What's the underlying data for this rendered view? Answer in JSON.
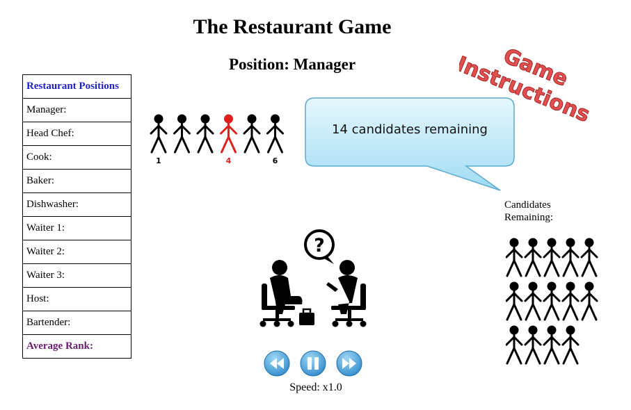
{
  "title": "The Restaurant Game",
  "position_line": "Position: Manager",
  "positions": {
    "header": "Restaurant Positions",
    "rows": [
      "Manager:",
      "Head Chef:",
      "Cook:",
      "Baker:",
      "Dishwasher:",
      "Waiter 1:",
      "Waiter 2:",
      "Waiter 3:",
      "Host:",
      "Bartender:"
    ],
    "average": "Average Rank:"
  },
  "lineup": {
    "count": 6,
    "highlighted_index": 4,
    "labels": [
      {
        "index": 1,
        "text": "1"
      },
      {
        "index": 4,
        "text": "4"
      },
      {
        "index": 6,
        "text": "6"
      }
    ],
    "figure_color": "#000000",
    "highlight_color": "#e02020"
  },
  "speech": {
    "text": "14 candidates remaining"
  },
  "instructions": {
    "line1": "Game",
    "line2": "Instructions",
    "color": "#e05050"
  },
  "candidates": {
    "label_line1": "Candidates",
    "label_line2": "Remaining:",
    "count": 14
  },
  "controls": {
    "rewind_icon": "rewind-icon",
    "pause_icon": "pause-icon",
    "forward_icon": "fast-forward-icon",
    "button_color": "#3a9fd8"
  },
  "speed": "Speed: x1.0"
}
